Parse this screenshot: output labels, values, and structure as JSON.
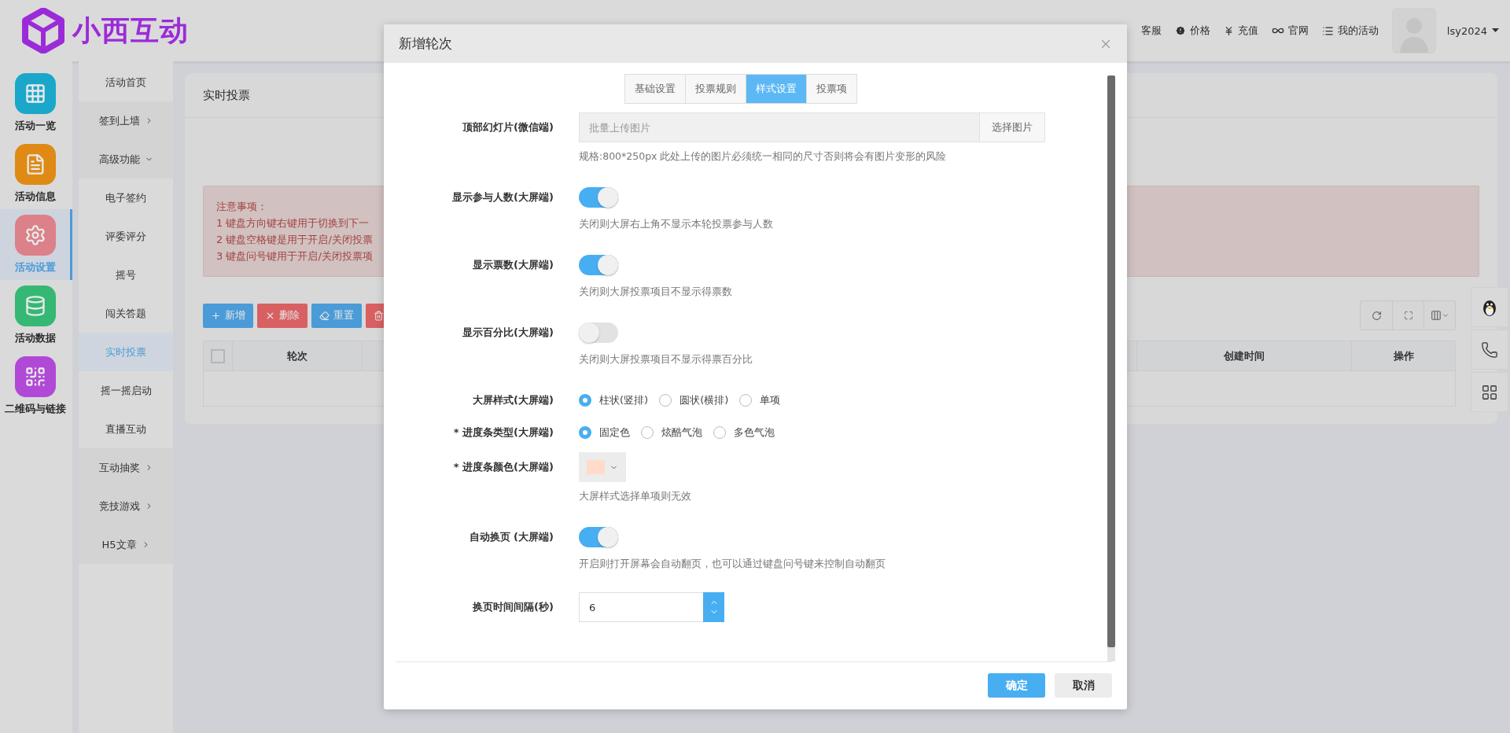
{
  "header": {
    "logo": "小西互动",
    "nav": [
      {
        "label": "客服",
        "kind": "none"
      },
      {
        "label": "价格",
        "kind": "badge"
      },
      {
        "label": "充值",
        "kind": "yen"
      },
      {
        "label": "官网",
        "kind": "infinity"
      },
      {
        "label": "我的活动",
        "kind": "list"
      }
    ],
    "user": "lsy2024"
  },
  "icon_sidebar": [
    {
      "label": "活动一览",
      "kind": "grid",
      "color": "#1ba7c9",
      "selected": false
    },
    {
      "label": "活动信息",
      "kind": "file",
      "color": "#de8a14",
      "selected": false
    },
    {
      "label": "活动设置",
      "kind": "gear",
      "color": "#dc8089",
      "selected": true
    },
    {
      "label": "活动数据",
      "kind": "database",
      "color": "#35b874",
      "selected": false
    },
    {
      "label": "二维码与链接",
      "kind": "qr",
      "color": "#b04ad6",
      "selected": false
    }
  ],
  "submenu": [
    {
      "label": "活动首页",
      "kind": "link",
      "selected": false
    },
    {
      "label": "签到上墙",
      "kind": "group",
      "expanded": false,
      "selected": false
    },
    {
      "label": "高级功能",
      "kind": "group",
      "expanded": true,
      "selected": false,
      "children": [
        {
          "label": "电子签约",
          "selected": false
        },
        {
          "label": "评委评分",
          "selected": false
        },
        {
          "label": "摇号",
          "selected": false
        },
        {
          "label": "闯关答题",
          "selected": false
        },
        {
          "label": "实时投票",
          "selected": true
        },
        {
          "label": "摇一摇启动",
          "selected": false
        },
        {
          "label": "直播互动",
          "selected": false
        }
      ]
    },
    {
      "label": "互动抽奖",
      "kind": "group",
      "expanded": false,
      "selected": false
    },
    {
      "label": "竞技游戏",
      "kind": "group",
      "expanded": false,
      "selected": false
    },
    {
      "label": "H5文章",
      "kind": "group",
      "expanded": false,
      "selected": false
    }
  ],
  "card": {
    "title": "实时投票",
    "alert": [
      "注意事项：",
      "1 键盘方向键右键用于切换到下一",
      "2 键盘空格键是用于开启/关闭投票",
      "3 键盘问号键用于开启/关闭投票项"
    ],
    "toolbar": [
      {
        "label": "新增",
        "kind": "add"
      },
      {
        "label": "删除",
        "kind": "delete"
      },
      {
        "label": "重置",
        "kind": "reset"
      },
      {
        "kind": "clear"
      }
    ],
    "table": {
      "columns": [
        {
          "label": "轮次",
          "kind": "left"
        },
        {
          "label": "创建时间",
          "kind": "right"
        },
        {
          "label": "操作",
          "kind": "right"
        }
      ],
      "select_all": false
    }
  },
  "dialog": {
    "title": "新增轮次",
    "tabs": [
      {
        "label": "基础设置",
        "selected": false
      },
      {
        "label": "投票规则",
        "selected": false
      },
      {
        "label": "样式设置",
        "selected": true
      },
      {
        "label": "投票项",
        "selected": false
      }
    ],
    "fields": [
      {
        "kind": "upload",
        "label": "顶部幻灯片(微信端)",
        "placeholder": "批量上传图片",
        "button": "选择图片",
        "hint": "规格:800*250px 此处上传的图片必须统一相同的尺寸否则将会有图片变形的风险"
      },
      {
        "kind": "switch",
        "label": "显示参与人数(大屏端)",
        "on": true,
        "hint": "关闭则大屏右上角不显示本轮投票参与人数"
      },
      {
        "kind": "switch",
        "label": "显示票数(大屏端)",
        "on": true,
        "hint": "关闭则大屏投票项目不显示得票数"
      },
      {
        "kind": "switch",
        "label": "显示百分比(大屏端)",
        "on": false,
        "hint": "关闭则大屏投票项目不显示得票百分比"
      },
      {
        "kind": "radio",
        "label": "大屏样式(大屏端)",
        "options": [
          {
            "label": "柱状(竖排)",
            "selected": true
          },
          {
            "label": "圆状(横排)",
            "selected": false
          },
          {
            "label": "单项",
            "selected": false
          }
        ]
      },
      {
        "kind": "radio",
        "label": "* 进度条类型(大屏端)",
        "options": [
          {
            "label": "固定色",
            "selected": true
          },
          {
            "label": "炫酷气泡",
            "selected": false
          },
          {
            "label": "多色气泡",
            "selected": false
          }
        ]
      },
      {
        "kind": "color",
        "label": "* 进度条颜色(大屏端)",
        "color": "#ffdcc9",
        "hint": "大屏样式选择单项则无效"
      },
      {
        "kind": "switch",
        "label": "自动换页 (大屏端)",
        "on": true,
        "hint": "开启则打开屏幕会自动翻页，也可以通过键盘问号键来控制自动翻页"
      },
      {
        "kind": "number",
        "label": "换页时间间隔(秒)",
        "value": "6"
      }
    ],
    "buttons": [
      {
        "label": "确定",
        "kind": "primary"
      },
      {
        "label": "取消",
        "kind": "default"
      }
    ]
  }
}
